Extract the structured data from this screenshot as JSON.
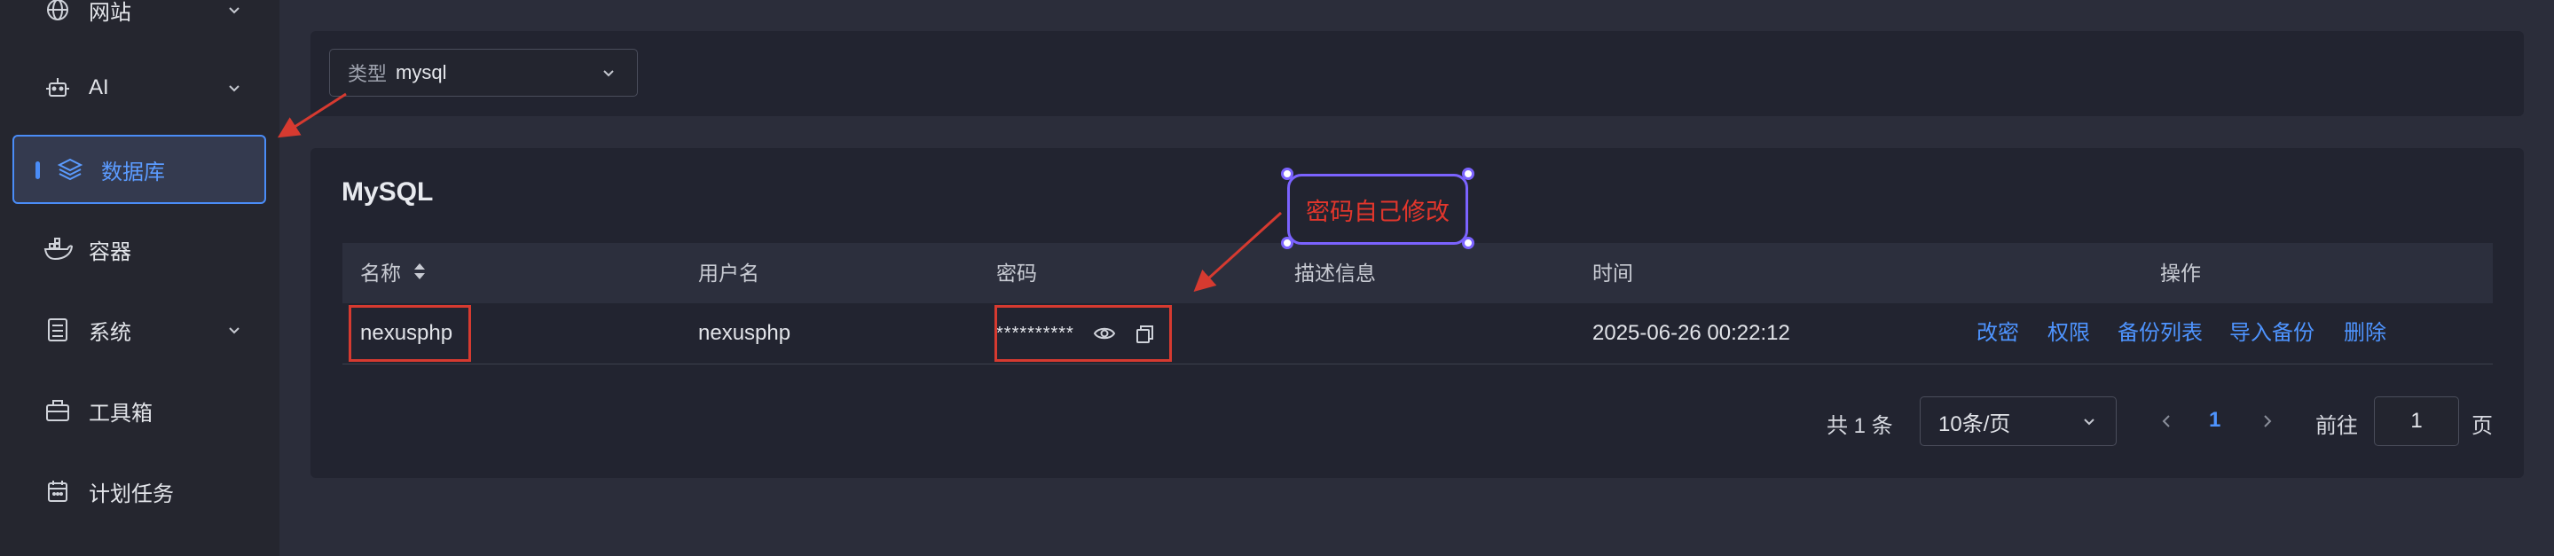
{
  "sidebar": {
    "items": [
      {
        "label": "网站",
        "icon": "globe-icon"
      },
      {
        "label": "AI",
        "icon": "robot-icon"
      },
      {
        "label": "数据库",
        "icon": "layers-icon"
      },
      {
        "label": "容器",
        "icon": "docker-icon"
      },
      {
        "label": "系统",
        "icon": "system-icon"
      },
      {
        "label": "工具箱",
        "icon": "toolbox-icon"
      },
      {
        "label": "计划任务",
        "icon": "calendar-icon"
      }
    ]
  },
  "filter": {
    "type_label": "类型",
    "type_value": "mysql"
  },
  "panel": {
    "title": "MySQL"
  },
  "table": {
    "headers": {
      "name": "名称",
      "username": "用户名",
      "password": "密码",
      "description": "描述信息",
      "time": "时间",
      "actions": "操作"
    },
    "rows": [
      {
        "name": "nexusphp",
        "username": "nexusphp",
        "password": "**********",
        "description": "",
        "time": "2025-06-26 00:22:12"
      }
    ],
    "actions": [
      "改密",
      "权限",
      "备份列表",
      "导入备份",
      "删除"
    ]
  },
  "pagination": {
    "total": "共 1 条",
    "page_size": "10条/页",
    "current_page": "1",
    "goto_label": "前往",
    "goto_value": "1",
    "page_suffix": "页"
  },
  "annotation": {
    "callout_text": "密码自己修改",
    "box_color": "#d63a30",
    "callout_color": "#7b63ff"
  }
}
